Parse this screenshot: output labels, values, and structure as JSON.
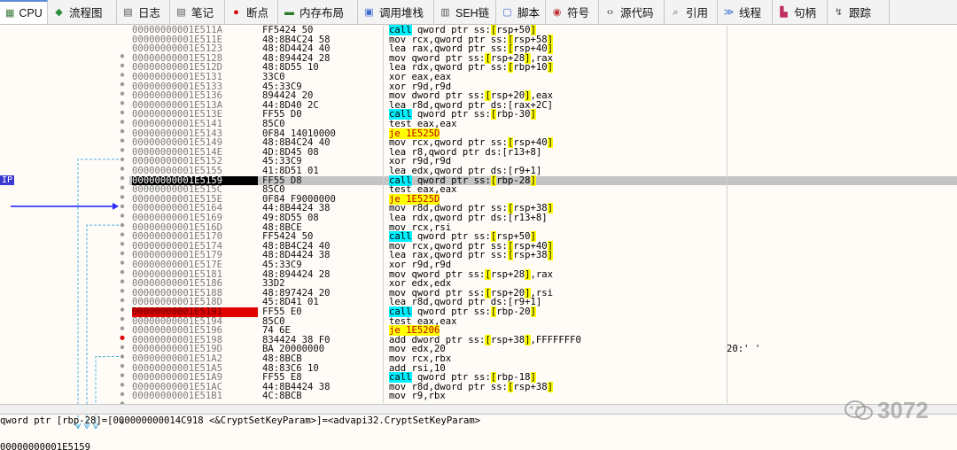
{
  "tabs": [
    {
      "label": "CPU",
      "icon": "cpu-icon",
      "glyph": "▦",
      "color": "#3a7a3a",
      "active": true
    },
    {
      "label": "流程图",
      "icon": "flowchart-icon",
      "glyph": "◆",
      "color": "#2a8a3a"
    },
    {
      "label": "日志",
      "icon": "log-icon",
      "glyph": "▤",
      "color": "#555"
    },
    {
      "label": "笔记",
      "icon": "notes-icon",
      "glyph": "▤",
      "color": "#555"
    },
    {
      "label": "断点",
      "icon": "breakpoint-icon",
      "glyph": "●",
      "color": "#d00000"
    },
    {
      "label": "内存布局",
      "icon": "memory-map-icon",
      "glyph": "▬",
      "color": "#2a7a2a"
    },
    {
      "label": "调用堆栈",
      "icon": "call-stack-icon",
      "glyph": "▣",
      "color": "#3a6ad0"
    },
    {
      "label": "SEH链",
      "icon": "seh-icon",
      "glyph": "▥",
      "color": "#555"
    },
    {
      "label": "脚本",
      "icon": "script-icon",
      "glyph": "▢",
      "color": "#3a6ad0"
    },
    {
      "label": "符号",
      "icon": "symbols-icon",
      "glyph": "◉",
      "color": "#c03030"
    },
    {
      "label": "源代码",
      "icon": "source-icon",
      "glyph": "‹›",
      "color": "#333"
    },
    {
      "label": "引用",
      "icon": "references-icon",
      "glyph": "⌕",
      "color": "#555"
    },
    {
      "label": "线程",
      "icon": "threads-icon",
      "glyph": "≫",
      "color": "#3a6ad0"
    },
    {
      "label": "句柄",
      "icon": "handles-icon",
      "glyph": "▙",
      "color": "#c03060"
    },
    {
      "label": "跟踪",
      "icon": "trace-icon",
      "glyph": "↯",
      "color": "#555"
    }
  ],
  "eip_label": "IP",
  "rows": [
    {
      "addr": "00000000001E511A",
      "bytes": "FF5424 50",
      "parts": [
        [
          "mn-call",
          "call"
        ],
        [
          "",
          "qword ptr ss:"
        ],
        [
          "br",
          "["
        ],
        [
          "",
          "rsp+50"
        ],
        [
          "br",
          "]"
        ]
      ],
      "cmt": ""
    },
    {
      "addr": "00000000001E511E",
      "bytes": "48:8B4C24 58",
      "parts": [
        [
          "",
          "mov rcx,qword ptr ss:"
        ],
        [
          "br",
          "["
        ],
        [
          "",
          "rsp+58"
        ],
        [
          "br",
          "]"
        ]
      ],
      "cmt": ""
    },
    {
      "addr": "00000000001E5123",
      "bytes": "48:8D4424 40",
      "parts": [
        [
          "",
          "lea rax,qword ptr ss:"
        ],
        [
          "br",
          "["
        ],
        [
          "",
          "rsp+40"
        ],
        [
          "br",
          "]"
        ]
      ],
      "cmt": ""
    },
    {
      "addr": "00000000001E5128",
      "bytes": "48:894424 28",
      "parts": [
        [
          "",
          "mov qword ptr ss:"
        ],
        [
          "br",
          "["
        ],
        [
          "",
          "rsp+28"
        ],
        [
          "br",
          "]"
        ],
        [
          "",
          ",rax"
        ]
      ],
      "cmt": ""
    },
    {
      "addr": "00000000001E512D",
      "bytes": "48:8D55 10",
      "parts": [
        [
          "",
          "lea rdx,qword ptr ss:"
        ],
        [
          "br",
          "["
        ],
        [
          "",
          "rbp+10"
        ],
        [
          "br",
          "]"
        ]
      ],
      "cmt": ""
    },
    {
      "addr": "00000000001E5131",
      "bytes": "33C0",
      "parts": [
        [
          "",
          "xor eax,eax"
        ]
      ],
      "cmt": ""
    },
    {
      "addr": "00000000001E5133",
      "bytes": "45:33C9",
      "parts": [
        [
          "",
          "xor r9d,r9d"
        ]
      ],
      "cmt": ""
    },
    {
      "addr": "00000000001E5136",
      "bytes": "894424 20",
      "parts": [
        [
          "",
          "mov dword ptr ss:"
        ],
        [
          "br",
          "["
        ],
        [
          "",
          "rsp+20"
        ],
        [
          "br",
          "]"
        ],
        [
          "",
          ",eax"
        ]
      ],
      "cmt": ""
    },
    {
      "addr": "00000000001E513A",
      "bytes": "44:8D40 2C",
      "parts": [
        [
          "",
          "lea r8d,qword ptr ds:[rax+2C]"
        ]
      ],
      "cmt": ""
    },
    {
      "addr": "00000000001E513E",
      "bytes": "FF55 D0",
      "parts": [
        [
          "mn-call",
          "call"
        ],
        [
          "",
          "qword ptr ss:"
        ],
        [
          "br",
          "["
        ],
        [
          "",
          "rbp-30"
        ],
        [
          "br",
          "]"
        ]
      ],
      "cmt": ""
    },
    {
      "addr": "00000000001E5141",
      "bytes": "85C0",
      "parts": [
        [
          "",
          "test eax,eax"
        ]
      ],
      "cmt": ""
    },
    {
      "addr": "00000000001E5143",
      "bytes": "0F84 14010000",
      "mark": "v",
      "parts": [
        [
          "mn-jmp",
          "je 1E525D"
        ]
      ],
      "cmt": ""
    },
    {
      "addr": "00000000001E5149",
      "bytes": "48:8B4C24 40",
      "parts": [
        [
          "",
          "mov rcx,qword ptr ss:"
        ],
        [
          "br",
          "["
        ],
        [
          "",
          "rsp+40"
        ],
        [
          "br",
          "]"
        ]
      ],
      "cmt": ""
    },
    {
      "addr": "00000000001E514E",
      "bytes": "4D:8D45 08",
      "parts": [
        [
          "",
          "lea r8,qword ptr ds:[r13+8]"
        ]
      ],
      "cmt": ""
    },
    {
      "addr": "00000000001E5152",
      "bytes": "45:33C9",
      "parts": [
        [
          "",
          "xor r9d,r9d"
        ]
      ],
      "cmt": ""
    },
    {
      "addr": "00000000001E5155",
      "bytes": "41:8D51 01",
      "parts": [
        [
          "",
          "lea edx,qword ptr ds:[r9+1]"
        ]
      ],
      "cmt": ""
    },
    {
      "addr": "00000000001E5159",
      "bytes": "FF55 D8",
      "eip": true,
      "parts": [
        [
          "mn-call",
          "call"
        ],
        [
          "",
          "qword ptr ss:"
        ],
        [
          "br",
          "["
        ],
        [
          "",
          "rbp-28"
        ],
        [
          "br",
          "]"
        ]
      ],
      "cmt": ""
    },
    {
      "addr": "00000000001E515C",
      "bytes": "85C0",
      "parts": [
        [
          "",
          "test eax,eax"
        ]
      ],
      "cmt": ""
    },
    {
      "addr": "00000000001E515E",
      "bytes": "0F84 F9000000",
      "mark": "v",
      "parts": [
        [
          "mn-jmp",
          "je 1E525D"
        ]
      ],
      "cmt": ""
    },
    {
      "addr": "00000000001E5164",
      "bytes": "44:8B4424 38",
      "parts": [
        [
          "",
          "mov r8d,dword ptr ss:"
        ],
        [
          "br",
          "["
        ],
        [
          "",
          "rsp+38"
        ],
        [
          "br",
          "]"
        ]
      ],
      "cmt": ""
    },
    {
      "addr": "00000000001E5169",
      "bytes": "49:8D55 08",
      "parts": [
        [
          "",
          "lea rdx,qword ptr ds:[r13+8]"
        ]
      ],
      "cmt": ""
    },
    {
      "addr": "00000000001E516D",
      "bytes": "48:8BCE",
      "parts": [
        [
          "",
          "mov rcx,rsi"
        ]
      ],
      "cmt": ""
    },
    {
      "addr": "00000000001E5170",
      "bytes": "FF5424 50",
      "parts": [
        [
          "mn-call",
          "call"
        ],
        [
          "",
          "qword ptr ss:"
        ],
        [
          "br",
          "["
        ],
        [
          "",
          "rsp+50"
        ],
        [
          "br",
          "]"
        ]
      ],
      "cmt": ""
    },
    {
      "addr": "00000000001E5174",
      "bytes": "48:8B4C24 40",
      "parts": [
        [
          "",
          "mov rcx,qword ptr ss:"
        ],
        [
          "br",
          "["
        ],
        [
          "",
          "rsp+40"
        ],
        [
          "br",
          "]"
        ]
      ],
      "cmt": ""
    },
    {
      "addr": "00000000001E5179",
      "bytes": "48:8D4424 38",
      "parts": [
        [
          "",
          "lea rax,qword ptr ss:"
        ],
        [
          "br",
          "["
        ],
        [
          "",
          "rsp+38"
        ],
        [
          "br",
          "]"
        ]
      ],
      "cmt": ""
    },
    {
      "addr": "00000000001E517E",
      "bytes": "45:33C9",
      "parts": [
        [
          "",
          "xor r9d,r9d"
        ]
      ],
      "cmt": ""
    },
    {
      "addr": "00000000001E5181",
      "bytes": "48:894424 28",
      "parts": [
        [
          "",
          "mov qword ptr ss:"
        ],
        [
          "br",
          "["
        ],
        [
          "",
          "rsp+28"
        ],
        [
          "br",
          "]"
        ],
        [
          "",
          ",rax"
        ]
      ],
      "cmt": ""
    },
    {
      "addr": "00000000001E5186",
      "bytes": "33D2",
      "parts": [
        [
          "",
          "xor edx,edx"
        ]
      ],
      "cmt": ""
    },
    {
      "addr": "00000000001E5188",
      "bytes": "48:897424 20",
      "parts": [
        [
          "",
          "mov qword ptr ss:"
        ],
        [
          "br",
          "["
        ],
        [
          "",
          "rsp+20"
        ],
        [
          "br",
          "]"
        ],
        [
          "",
          ",rsi"
        ]
      ],
      "cmt": ""
    },
    {
      "addr": "00000000001E518D",
      "bytes": "45:8D41 01",
      "parts": [
        [
          "",
          "lea r8d,qword ptr ds:[r9+1]"
        ]
      ],
      "cmt": ""
    },
    {
      "addr": "00000000001E5191",
      "bytes": "FF55 E0",
      "bp": true,
      "parts": [
        [
          "mn-call",
          "call"
        ],
        [
          "",
          "qword ptr ss:"
        ],
        [
          "br",
          "["
        ],
        [
          "",
          "rbp-20"
        ],
        [
          "br",
          "]"
        ]
      ],
      "cmt": ""
    },
    {
      "addr": "00000000001E5194",
      "bytes": "85C0",
      "parts": [
        [
          "",
          "test eax,eax"
        ]
      ],
      "cmt": ""
    },
    {
      "addr": "00000000001E5196",
      "bytes": "74 6E",
      "mark": "v",
      "parts": [
        [
          "mn-jmp",
          "je 1E5206"
        ]
      ],
      "cmt": ""
    },
    {
      "addr": "00000000001E5198",
      "bytes": "834424 38 F0",
      "parts": [
        [
          "",
          "add dword ptr ss:"
        ],
        [
          "br",
          "["
        ],
        [
          "",
          "rsp+38"
        ],
        [
          "br",
          "]"
        ],
        [
          "",
          ",FFFFFFF0"
        ]
      ],
      "cmt": ""
    },
    {
      "addr": "00000000001E519D",
      "bytes": "BA 20000000",
      "parts": [
        [
          "",
          "mov edx,20"
        ]
      ],
      "cmt": "20:' '"
    },
    {
      "addr": "00000000001E51A2",
      "bytes": "48:8BCB",
      "parts": [
        [
          "",
          "mov rcx,rbx"
        ]
      ],
      "cmt": ""
    },
    {
      "addr": "00000000001E51A5",
      "bytes": "48:83C6 10",
      "parts": [
        [
          "",
          "add rsi,10"
        ]
      ],
      "cmt": ""
    },
    {
      "addr": "00000000001E51A9",
      "bytes": "FF55 E8",
      "parts": [
        [
          "mn-call",
          "call"
        ],
        [
          "",
          "qword ptr ss:"
        ],
        [
          "br",
          "["
        ],
        [
          "",
          "rbp-18"
        ],
        [
          "br",
          "]"
        ]
      ],
      "cmt": ""
    },
    {
      "addr": "00000000001E51AC",
      "bytes": "44:8B4424 38",
      "parts": [
        [
          "",
          "mov r8d,dword ptr ss:"
        ],
        [
          "br",
          "["
        ],
        [
          "",
          "rsp+38"
        ],
        [
          "br",
          "]"
        ]
      ],
      "cmt": ""
    },
    {
      "addr": "00000000001E51B1",
      "bytes": "4C:8BCB",
      "parts": [
        [
          "",
          "mov r9,rbx"
        ]
      ],
      "cmt": ""
    }
  ],
  "info_line": "qword ptr [rbp-28]=[000000000014C918 <&CryptSetKeyParam>]=<advapi32.CryptSetKeyParam>",
  "info_line2": "00000000001E5159",
  "watermark": "3072"
}
